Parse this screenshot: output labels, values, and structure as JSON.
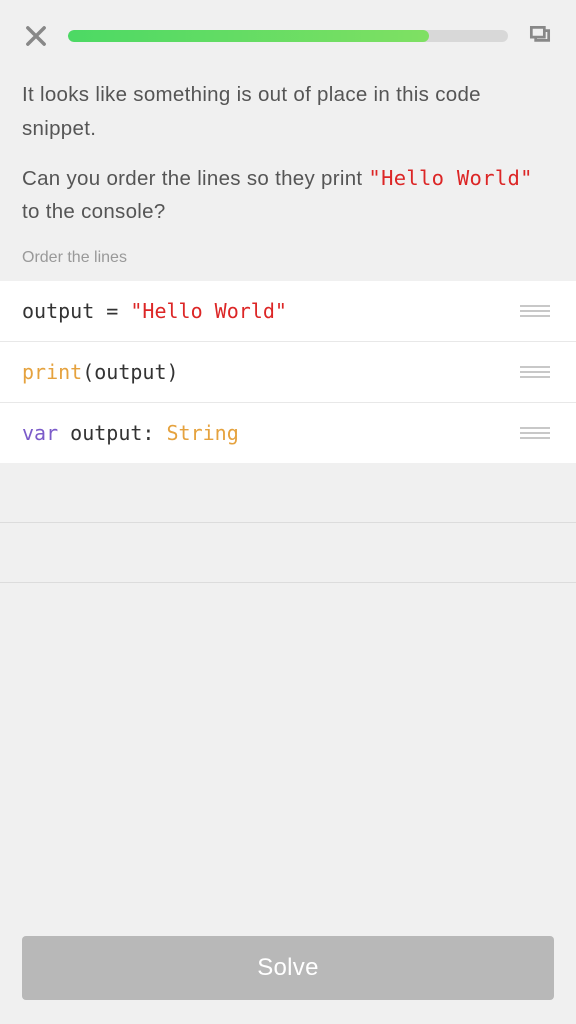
{
  "progress": {
    "percent": 82
  },
  "question": {
    "p1": "It looks like something is out of place in this code snippet.",
    "p2_pre": "Can you order the lines so they print ",
    "p2_code": "\"Hello World\"",
    "p2_post": " to the console?"
  },
  "instruction": "Order the lines",
  "lines": [
    {
      "tokens": [
        {
          "text": "output",
          "cls": "tok-id"
        },
        {
          "text": " = ",
          "cls": "tok-op"
        },
        {
          "text": "\"Hello World\"",
          "cls": "tok-str"
        }
      ]
    },
    {
      "tokens": [
        {
          "text": "print",
          "cls": "tok-fn"
        },
        {
          "text": "(",
          "cls": "tok-paren"
        },
        {
          "text": "output",
          "cls": "tok-id"
        },
        {
          "text": ")",
          "cls": "tok-paren"
        }
      ]
    },
    {
      "tokens": [
        {
          "text": "var",
          "cls": "tok-kw"
        },
        {
          "text": " output: ",
          "cls": "tok-id"
        },
        {
          "text": "String",
          "cls": "tok-type"
        }
      ]
    }
  ],
  "solve_label": "Solve"
}
